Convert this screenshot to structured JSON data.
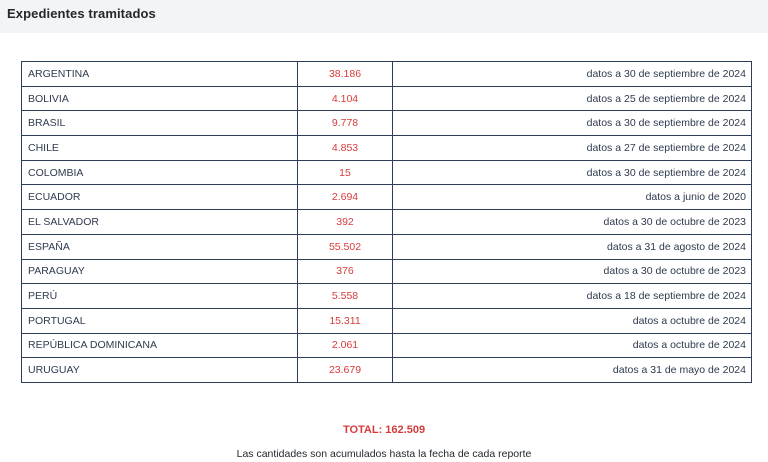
{
  "header": {
    "title": "Expedientes tramitados"
  },
  "rows": [
    {
      "country": "ARGENTINA",
      "count": "38.186",
      "info": "datos a 30 de septiembre de 2024"
    },
    {
      "country": "BOLIVIA",
      "count": "4.104",
      "info": "datos a 25 de septiembre de 2024"
    },
    {
      "country": "BRASIL",
      "count": "9.778",
      "info": "datos a 30 de septiembre de 2024"
    },
    {
      "country": "CHILE",
      "count": "4.853",
      "info": "datos a 27 de septiembre de 2024"
    },
    {
      "country": "COLOMBIA",
      "count": "15",
      "info": "datos a 30 de septiembre de 2024"
    },
    {
      "country": "ECUADOR",
      "count": "2.694",
      "info": "datos a junio de 2020"
    },
    {
      "country": "EL SALVADOR",
      "count": "392",
      "info": "datos a 30 de octubre de 2023"
    },
    {
      "country": "ESPAÑA",
      "count": "55.502",
      "info": "datos a 31 de agosto de 2024"
    },
    {
      "country": "PARAGUAY",
      "count": "376",
      "info": "datos a 30 de octubre de 2023"
    },
    {
      "country": "PERÚ",
      "count": "5.558",
      "info": "datos a 18 de septiembre de 2024"
    },
    {
      "country": "PORTUGAL",
      "count": "15.311",
      "info": "datos a octubre de 2024"
    },
    {
      "country": "REPÚBLICA DOMINICANA",
      "count": "2.061",
      "info": "datos a octubre de 2024"
    },
    {
      "country": "URUGUAY",
      "count": "23.679",
      "info": "datos a 31 de mayo de 2024"
    }
  ],
  "summary": {
    "total": "TOTAL: 162.509",
    "note": "Las cantidades son acumulados hasta la fecha de cada reporte"
  },
  "colors": {
    "accent": "#d73b3b",
    "text": "#2e3b4e",
    "border": "#2c3e57",
    "header_bg": "#f3f4f5"
  }
}
